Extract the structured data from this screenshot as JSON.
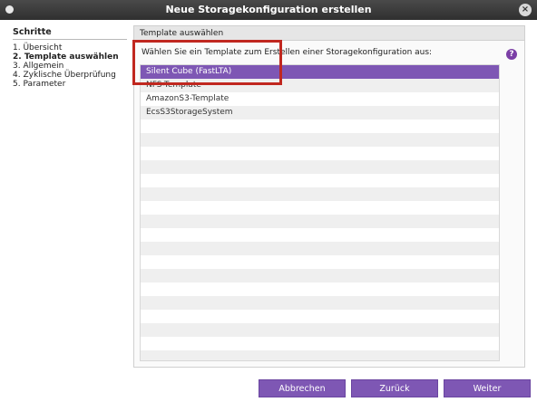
{
  "window": {
    "title": "Neue Storagekonfiguration erstellen"
  },
  "steps": {
    "heading": "Schritte",
    "items": [
      "1. Übersicht",
      "2. Template auswählen",
      "3. Allgemein",
      "4. Zyklische Überprüfung",
      "5. Parameter"
    ],
    "active_index": 1
  },
  "panel": {
    "heading": "Template auswählen",
    "instruction": "Wählen Sie ein Template zum Erstellen einer Storagekonfiguration aus:",
    "help_label": "?"
  },
  "templates": {
    "items": [
      "Silent Cube (FastLTA)",
      "NFS-Template",
      "AmazonS3-Template",
      "EcsS3StorageSystem"
    ],
    "selected_index": 0
  },
  "buttons": {
    "cancel": "Abbrechen",
    "back": "Zurück",
    "next": "Weiter"
  },
  "colors": {
    "accent": "#7e57b4",
    "highlight_border": "#c0271f",
    "titlebar": "#3a3a3a"
  }
}
